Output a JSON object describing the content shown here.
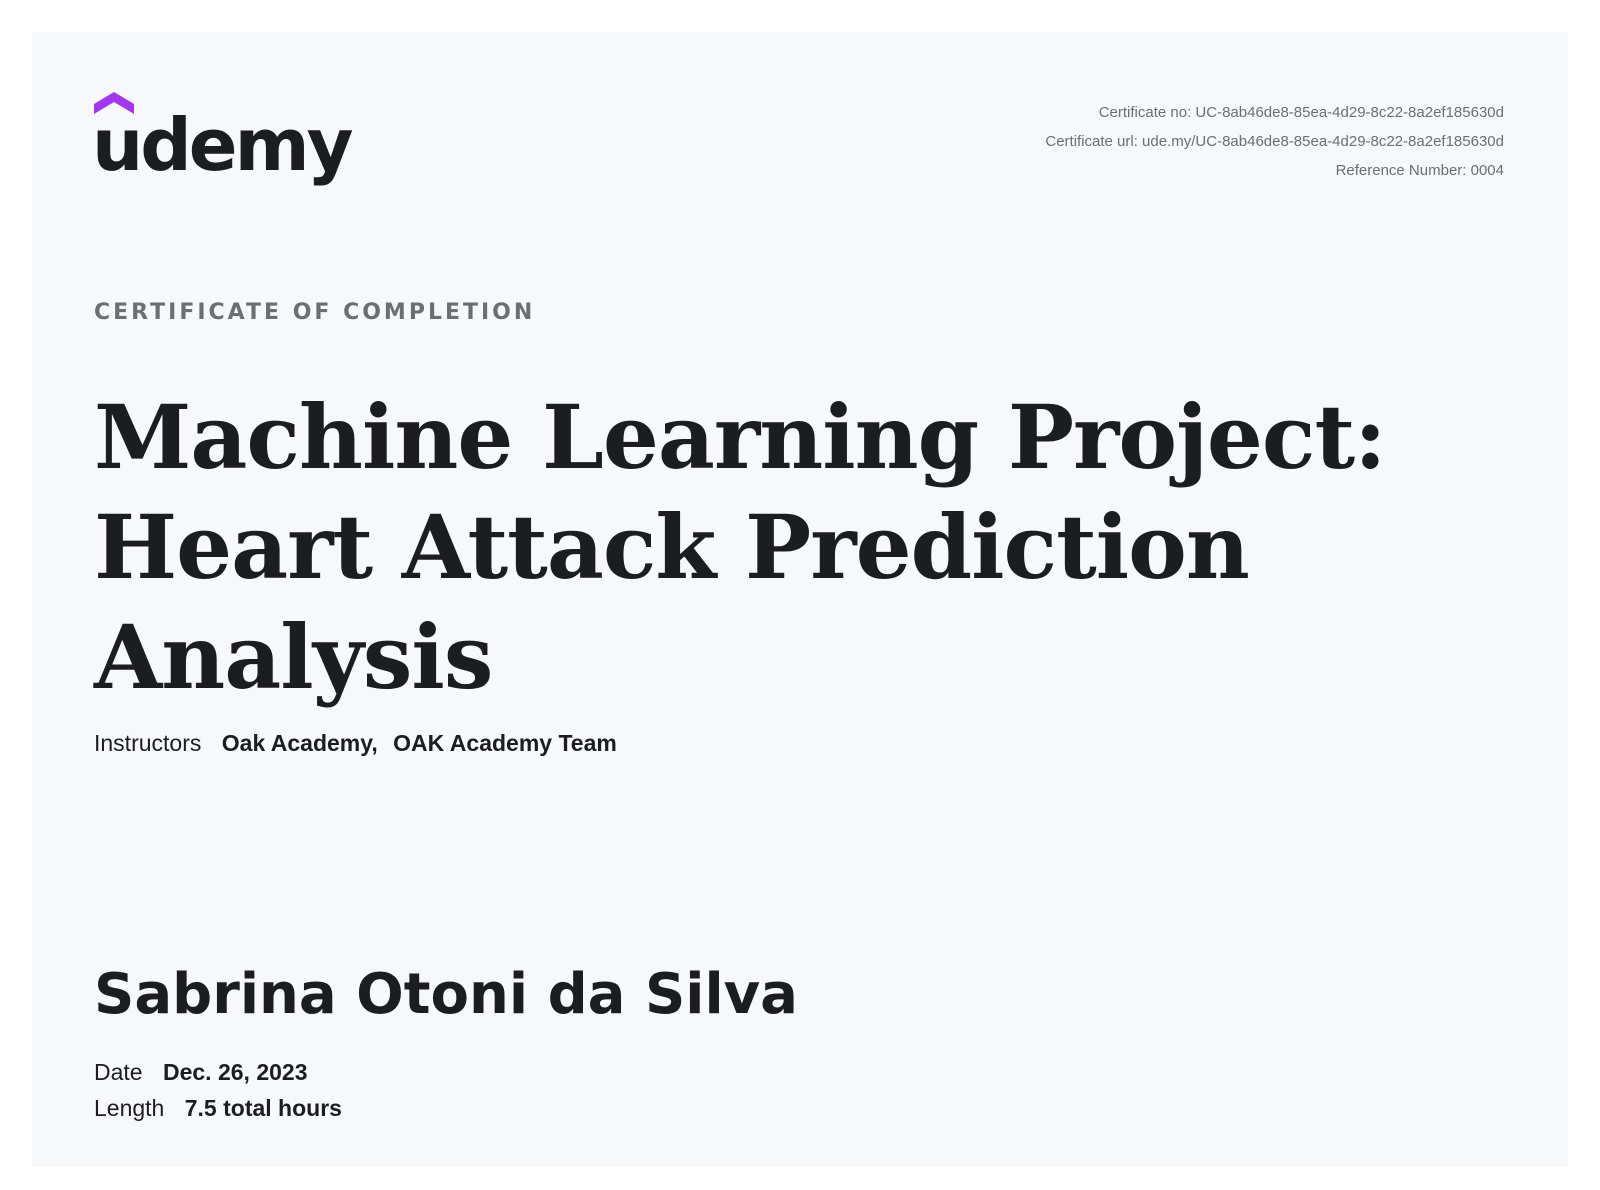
{
  "brand": {
    "logo_text": "udemy",
    "accent_color": "#a435f0",
    "text_color": "#1c1d1f"
  },
  "meta": {
    "certificate_no": "Certificate no: UC-8ab46de8-85ea-4d29-8c22-8a2ef185630d",
    "certificate_url": "Certificate url: ude.my/UC-8ab46de8-85ea-4d29-8c22-8a2ef185630d",
    "reference_number": "Reference Number: 0004"
  },
  "certificate": {
    "eyebrow": "CERTIFICATE OF COMPLETION",
    "course_title": "Machine Learning Project: Heart Attack Prediction Analysis",
    "instructors_label": "Instructors",
    "instructors": [
      "Oak Academy",
      "OAK Academy Team"
    ],
    "instructor_separator": ",",
    "recipient_name": "Sabrina Otoni da Silva",
    "date_label": "Date",
    "date_value": "Dec. 26, 2023",
    "length_label": "Length",
    "length_value": "7.5 total hours"
  }
}
